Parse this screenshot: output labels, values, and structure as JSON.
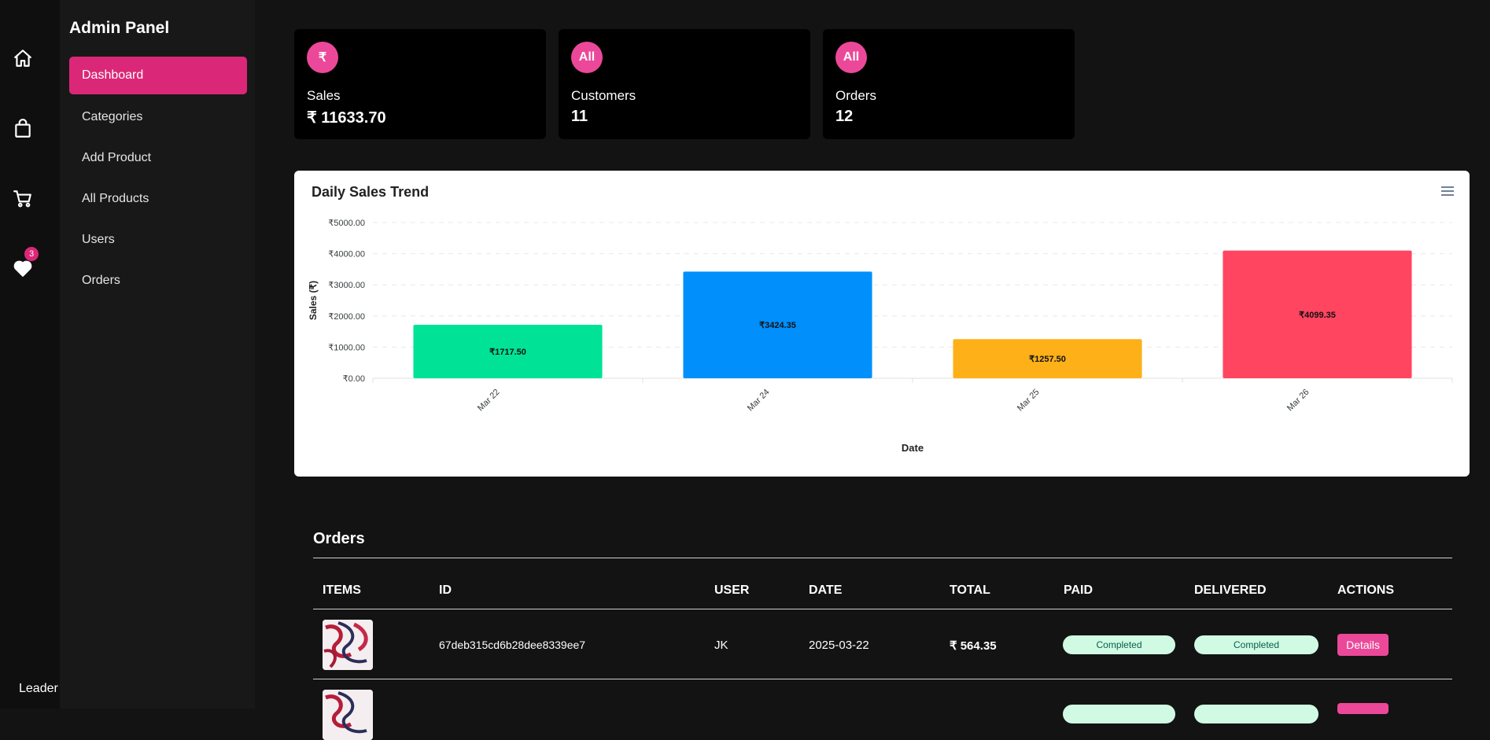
{
  "leader_label": "Leader",
  "favorites_count": "3",
  "panel_title": "Admin Panel",
  "nav": [
    {
      "label": "Dashboard",
      "active": true
    },
    {
      "label": "Categories"
    },
    {
      "label": "Add Product"
    },
    {
      "label": "All Products"
    },
    {
      "label": "Users"
    },
    {
      "label": "Orders"
    }
  ],
  "stats": [
    {
      "badge": "₹",
      "label": "Sales",
      "value": "₹ 11633.70"
    },
    {
      "badge": "All",
      "label": "Customers",
      "value": "11"
    },
    {
      "badge": "All",
      "label": "Orders",
      "value": "12"
    }
  ],
  "chart_data": {
    "type": "bar",
    "title": "Daily Sales Trend",
    "xlabel": "Date",
    "ylabel": "Sales (₹)",
    "categories": [
      "Mar 22",
      "Mar 24",
      "Mar 25",
      "Mar 26"
    ],
    "values": [
      1717.5,
      3424.35,
      1257.5,
      4099.35
    ],
    "data_labels": [
      "₹1717.50",
      "₹3424.35",
      "₹1257.50",
      "₹4099.35"
    ],
    "colors": [
      "#00e396",
      "#008ffb",
      "#feb019",
      "#ff4560"
    ],
    "ylim": [
      0,
      5000
    ],
    "yticks": [
      "₹0.00",
      "₹1000.00",
      "₹2000.00",
      "₹3000.00",
      "₹4000.00",
      "₹5000.00"
    ],
    "grid": true,
    "legend": "none"
  },
  "orders": {
    "title": "Orders",
    "headers": [
      "ITEMS",
      "ID",
      "USER",
      "DATE",
      "TOTAL",
      "PAID",
      "DELIVERED",
      "ACTIONS"
    ],
    "rows": [
      {
        "id": "67deb315cd6b28dee8339ee7",
        "user": "JK",
        "date": "2025-03-22",
        "total": "₹ 564.35",
        "paid": "Completed",
        "delivered": "Completed",
        "action": "Details"
      }
    ]
  }
}
